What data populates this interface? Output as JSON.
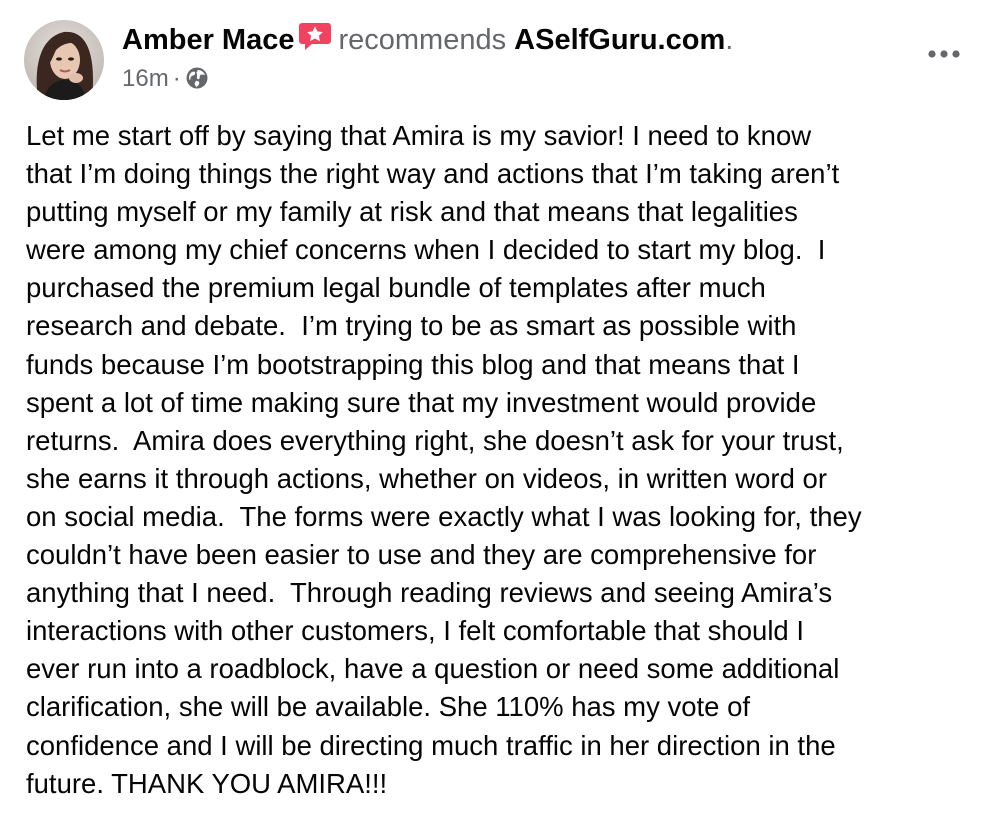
{
  "post": {
    "author": {
      "name": "Amber Mace",
      "avatar": "avatar-photo",
      "badge_icon": "recommendation-star-icon",
      "badge_color": "#f3425f"
    },
    "action": "recommends",
    "target_page": "ASelfGuru.com",
    "trailing_period": ".",
    "timestamp": "16m",
    "separator": "·",
    "audience_icon": "globe-icon",
    "more_icon": "more-options-icon",
    "lines": [
      "Let me start off by saying that Amira is my savior! I need to know",
      "that I’m doing things the right way and actions that I’m taking aren’t",
      "putting myself or my family at risk and that means that legalities",
      "were among my chief concerns when I decided to start my blog.  I",
      "purchased the premium legal bundle of templates after much",
      "research and debate.  I’m trying to be as smart as possible with",
      "funds because I’m bootstrapping this blog and that means that I",
      "spent a lot of time making sure that my investment would provide",
      "returns.  Amira does everything right, she doesn’t ask for your trust,",
      "she earns it through actions, whether on videos, in written word or",
      "on social media.  The forms were exactly what I was looking for, they",
      "couldn’t have been easier to use and they are comprehensive for",
      "anything that I need.  Through reading reviews and seeing Amira’s",
      "interactions with other customers, I felt comfortable that should I",
      "ever run into a roadblock, have a question or need some additional",
      "clarification, she will be available. She 110% has my vote of",
      "confidence and I will be directing much traffic in her direction in the",
      "future. THANK YOU AMIRA!!!"
    ]
  }
}
